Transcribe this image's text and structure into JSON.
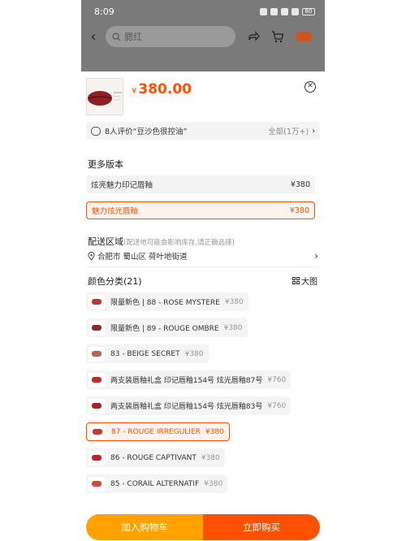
{
  "status_bar": {
    "time": "8:09",
    "battery": "80"
  },
  "search": {
    "placeholder": "腮红"
  },
  "sheet": {
    "price_symbol": "¥",
    "price": "380.00",
    "review": {
      "text": "8人评价“豆沙色很控油”",
      "total": "全部(1万+)"
    },
    "versions_title": "更多版本",
    "versions": [
      {
        "label": "炫亮魅力印记唇釉",
        "price": "¥380",
        "selected": false
      },
      {
        "label": "魅力炫光唇釉",
        "price": "¥380",
        "selected": true
      }
    ],
    "delivery": {
      "title": "配送区域",
      "note": "(配送地可能会影响库存,请正确选择)",
      "address": "合肥市 蜀山区 荷叶地街道"
    },
    "colors_title": "颜色分类(21)",
    "big_view_label": "大图",
    "colors": [
      {
        "label": "限量新色 | 88 - ROSE MYSTERE",
        "price": "¥380",
        "swatch": "#b53a3c",
        "selected": false
      },
      {
        "label": "限量新色 | 89 - ROUGE OMBRE",
        "price": "¥380",
        "swatch": "#8e2a2c",
        "selected": false
      },
      {
        "label": "83 - BEIGE SECRET",
        "price": "¥380",
        "swatch": "#b8625a",
        "selected": false
      },
      {
        "label": "两支装唇釉礼盒 印记唇釉154号 炫光唇釉87号",
        "price": "¥760",
        "swatch": "#c02a2a",
        "selected": false
      },
      {
        "label": "两支装唇釉礼盒 印记唇釉154号 炫光唇釉83号",
        "price": "¥760",
        "swatch": "#a32626",
        "selected": false
      },
      {
        "label": "87 - ROUGE IRREGULIER",
        "price": "¥380",
        "swatch": "#c53a3a",
        "selected": true
      },
      {
        "label": "86 - ROUGE CAPTIVANT",
        "price": "¥380",
        "swatch": "#c2202a",
        "selected": false
      },
      {
        "label": "85 - CORAIL ALTERNATIF",
        "price": "¥380",
        "swatch": "#d8463a",
        "selected": false
      }
    ],
    "add_to_cart": "加入购物车",
    "buy_now": "立即购买"
  },
  "colors": {
    "accent": "#ff5000",
    "cart": "#ffa200"
  }
}
